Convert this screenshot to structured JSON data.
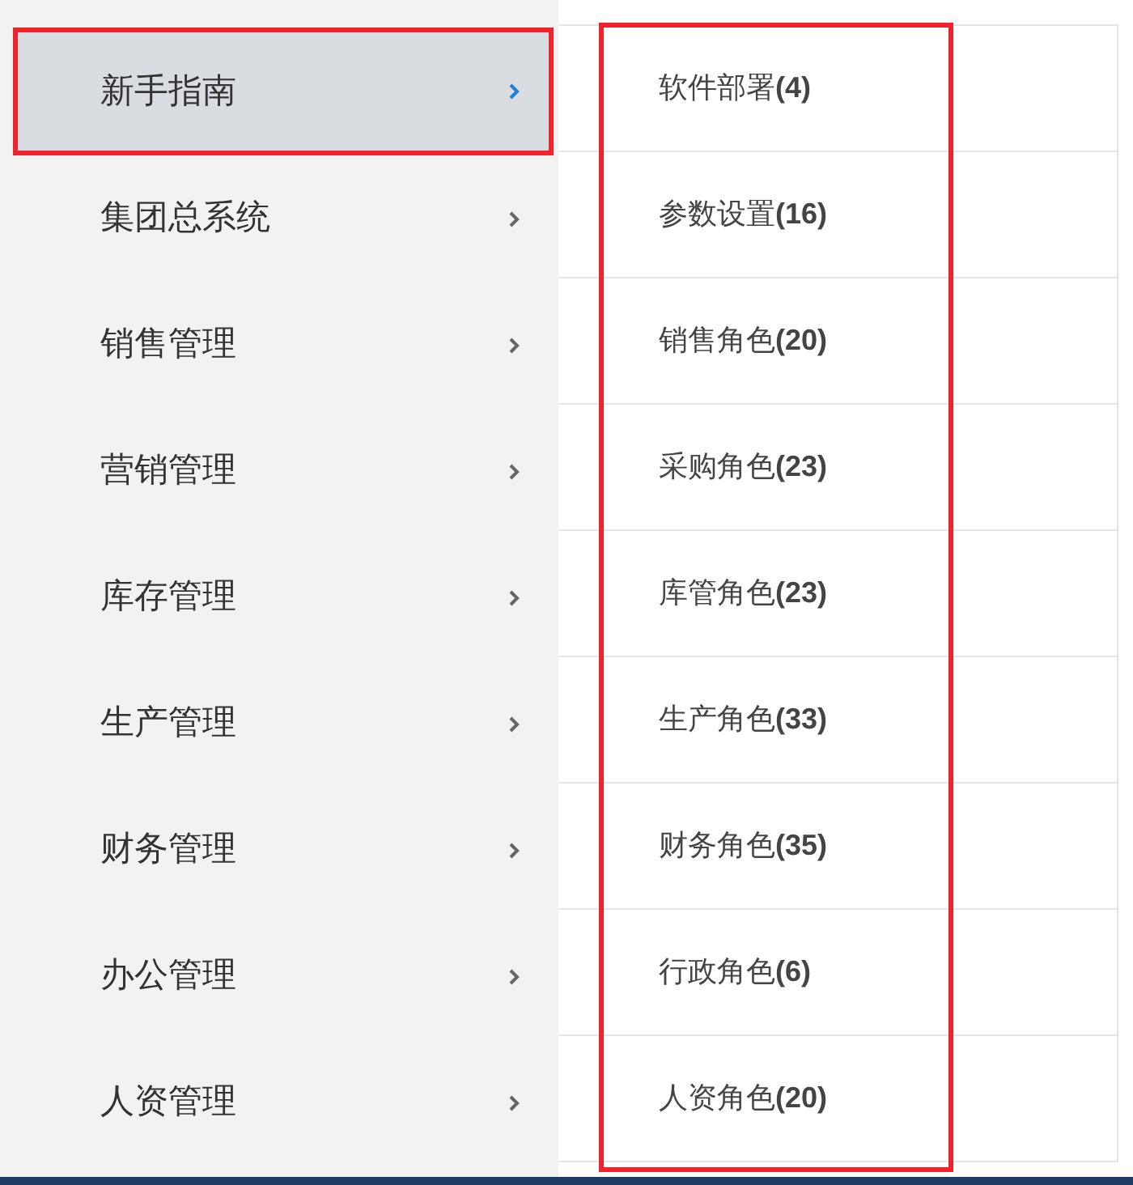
{
  "menu": [
    {
      "label": "新手指南",
      "selected": true
    },
    {
      "label": "集团总系统",
      "selected": false
    },
    {
      "label": "销售管理",
      "selected": false
    },
    {
      "label": "营销管理",
      "selected": false
    },
    {
      "label": "库存管理",
      "selected": false
    },
    {
      "label": "生产管理",
      "selected": false
    },
    {
      "label": "财务管理",
      "selected": false
    },
    {
      "label": "办公管理",
      "selected": false
    },
    {
      "label": "人资管理",
      "selected": false
    }
  ],
  "submenu": [
    "软件部署**(4)**",
    "参数设置**(16)**",
    "销售角色**(20)**",
    "采购角色**(23)**",
    "库管角色**(23)**",
    "生产角色**(33)**",
    "财务角色**(35)**",
    "行政角色**(6)**",
    "人资角色**(20)**"
  ]
}
